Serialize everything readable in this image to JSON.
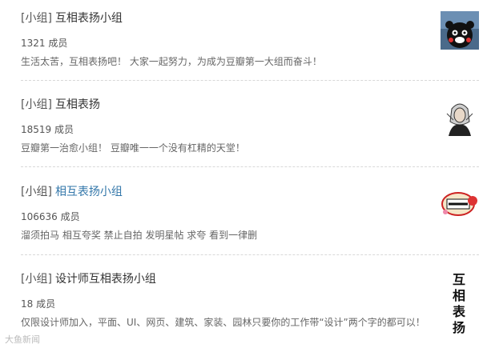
{
  "groups": [
    {
      "tag": "[小组]",
      "name": "互相表扬小组",
      "members": "1321 成员",
      "description": "生活太苦，互相表扬吧！ 大家一起努力，为成为豆瓣第一大组而奋斗！",
      "avatar_icon": "bear-mascot-avatar"
    },
    {
      "tag": "[小组]",
      "name": "互相表扬",
      "members": "18519 成员",
      "description": "豆瓣第一治愈小组！ 豆瓣唯一一个没有杠精的天堂！",
      "avatar_icon": "person-sketch-avatar"
    },
    {
      "tag": "[小组]",
      "name": "相互表扬小组",
      "members": "106636 成员",
      "description": "溜须拍马 相互夸奖 禁止自拍 发明星帖 求夸 看到一律删",
      "avatar_icon": "sticker-avatar"
    },
    {
      "tag": "[小组]",
      "name": "设计师互相表扬小组",
      "members": "18 成员",
      "description": "仅限设计师加入，平面、UI、网页、建筑、家装、园林只要你的工作带“设计”两个字的都可以！",
      "avatar_text_line1": "互 相",
      "avatar_text_line2": "表 扬"
    }
  ],
  "watermark": "大鱼新闻"
}
